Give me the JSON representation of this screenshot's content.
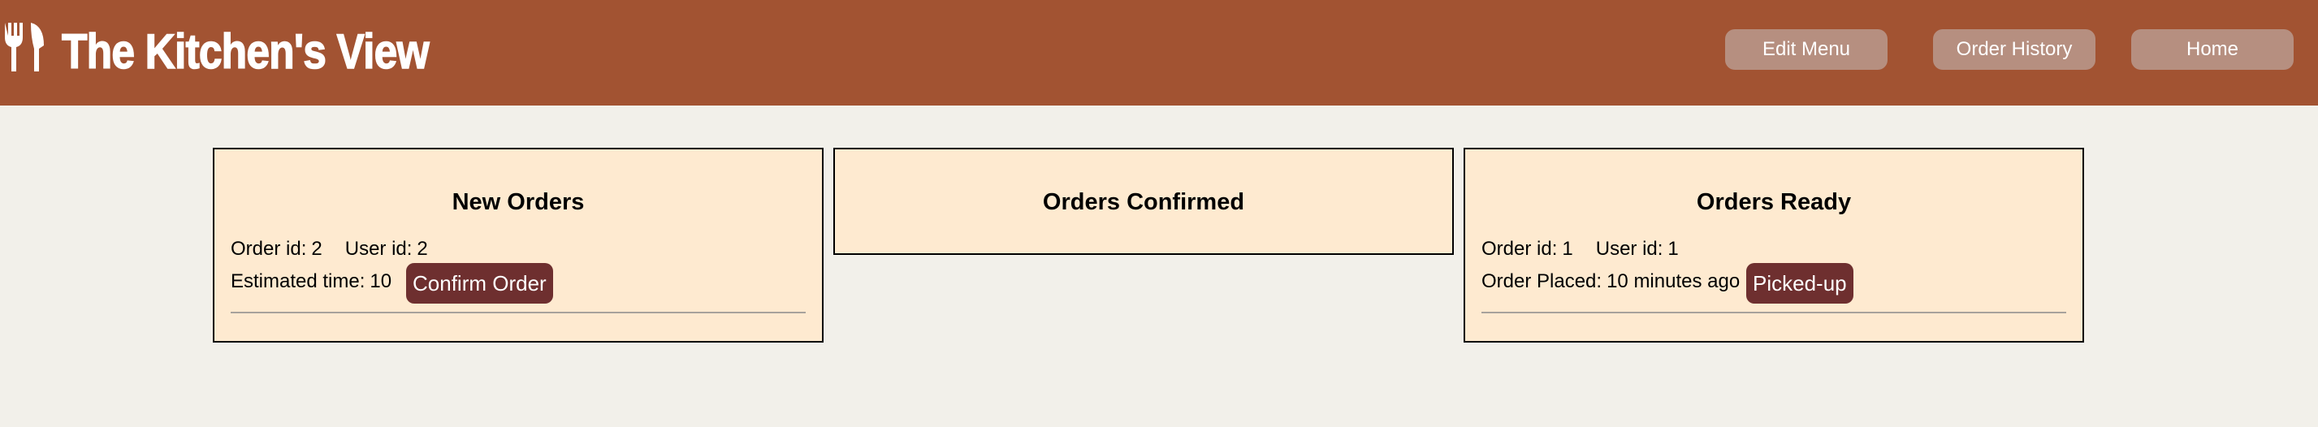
{
  "header": {
    "brand": "The Kitchen's View",
    "logo_icon": "fork-knife-icon",
    "nav": {
      "edit_menu": "Edit Menu",
      "order_history": "Order History",
      "home": "Home"
    }
  },
  "colors": {
    "header_bg": "#a25332",
    "nav_button_bg": "#b68f80",
    "page_bg": "#f2f0ea",
    "panel_bg": "#feead0",
    "action_button_bg": "#6e2f2f"
  },
  "panels": {
    "new_orders": {
      "title": "New Orders",
      "order": {
        "order_id_label": "Order id:",
        "order_id": "2",
        "user_id_label": "User id:",
        "user_id": "2",
        "estimated_label": "Estimated time:",
        "estimated_time": "10",
        "action": "Confirm Order"
      }
    },
    "orders_confirmed": {
      "title": "Orders Confirmed"
    },
    "orders_ready": {
      "title": "Orders Ready",
      "order": {
        "order_id_label": "Order id:",
        "order_id": "1",
        "user_id_label": "User id:",
        "user_id": "1",
        "placed_label": "Order Placed:",
        "placed_value": "10 minutes ago",
        "action": "Picked-up"
      }
    }
  }
}
